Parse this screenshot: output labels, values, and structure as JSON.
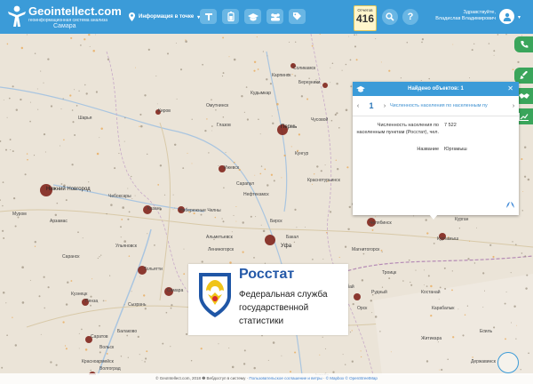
{
  "header": {
    "logo_title": "Geointellect",
    "logo_suffix": ".com",
    "logo_subtitle": "геоинформационная система анализа",
    "city": "Самара",
    "location_label": "Информация в точке",
    "counter_label": "Отчетов",
    "counter_value": "416",
    "greeting": "Здравствуйте,",
    "user_name": "Владислав Владимирович"
  },
  "panel": {
    "title": "Найдено объектов: 1",
    "page": "1",
    "tab_label": "Численность населения по населенным пу",
    "rows": [
      {
        "key": "Численность населения по населенным пунктам (Росстат), чел.",
        "value": "7 522"
      },
      {
        "key": "Название",
        "value": "Юргамыш"
      }
    ]
  },
  "rosstat": {
    "title": "Росстат",
    "subtitle_lines": [
      "Федеральная служба",
      "государственной",
      "статистики"
    ]
  },
  "map_labels": [
    {
      "text": "Соликамск",
      "big": false
    },
    {
      "text": "Березники",
      "big": false
    },
    {
      "text": "Кудымкар",
      "big": false
    },
    {
      "text": "Омутнинск",
      "big": false
    },
    {
      "text": "Киров",
      "big": false
    },
    {
      "text": "Глазов",
      "big": false
    },
    {
      "text": "Пермь",
      "big": true
    },
    {
      "text": "Чусовой",
      "big": false
    },
    {
      "text": "Шарья",
      "big": false
    },
    {
      "text": "Нижний Новгород",
      "big": true
    },
    {
      "text": "Чебоксары",
      "big": false
    },
    {
      "text": "Ижевск",
      "big": false
    },
    {
      "text": "Кунгур",
      "big": false
    },
    {
      "text": "Краснотурьинск",
      "big": false
    },
    {
      "text": "Казань",
      "big": false
    },
    {
      "text": "Сарапул",
      "big": false
    },
    {
      "text": "Нефтекамск",
      "big": false
    },
    {
      "text": "Набережные Челны",
      "big": false
    },
    {
      "text": "Альметьевск",
      "big": false
    },
    {
      "text": "Бирск",
      "big": false
    },
    {
      "text": "Уфа",
      "big": true
    },
    {
      "text": "Челябинск",
      "big": false
    },
    {
      "text": "Курган",
      "big": false
    },
    {
      "text": "Куртамыш",
      "big": false
    },
    {
      "text": "Тольятти",
      "big": false
    },
    {
      "text": "Самара",
      "big": false
    },
    {
      "text": "Ульяновск",
      "big": false
    },
    {
      "text": "Пенза",
      "big": false
    },
    {
      "text": "Саратов",
      "big": false
    },
    {
      "text": "Балаково",
      "big": false
    },
    {
      "text": "Вольск",
      "big": false
    },
    {
      "text": "Сызрань",
      "big": false
    },
    {
      "text": "Бузулук",
      "big": false
    },
    {
      "text": "Орск",
      "big": false
    },
    {
      "text": "Магнитогорск",
      "big": false
    },
    {
      "text": "Троицк",
      "big": false
    },
    {
      "text": "Костанай",
      "big": false
    },
    {
      "text": "Рудный",
      "big": false
    },
    {
      "text": "Волгоград",
      "big": false
    },
    {
      "text": "Красноармейск",
      "big": false
    },
    {
      "text": "Муром",
      "big": false
    },
    {
      "text": "Арзамас",
      "big": false
    },
    {
      "text": "Саранск",
      "big": false
    },
    {
      "text": "Кузнецк",
      "big": false
    },
    {
      "text": "Белорецк",
      "big": false
    },
    {
      "text": "Актобе",
      "big": false
    },
    {
      "text": "Державинск",
      "big": false
    },
    {
      "text": "Житикара",
      "big": false
    },
    {
      "text": "Есиль",
      "big": false
    },
    {
      "text": "Карабалык",
      "big": false
    },
    {
      "text": "Лениногорск",
      "big": false
    },
    {
      "text": "Сибай",
      "big": false
    },
    {
      "text": "Карпинск",
      "big": false
    },
    {
      "text": "Бакал",
      "big": false
    }
  ],
  "footer": {
    "left": "© GeoIntellect.com, 2018 ❷ Вебдоступ в систему ·",
    "link1": "Пользовательское соглашение и ветры",
    "mid": " · ",
    "link2": "© Mapbox © OpenStreetMap"
  },
  "colors": {
    "brand": "#3b9bd8",
    "side_green": "#3aa55b",
    "dot_dark": "#7a1a12",
    "dot_orange": "#e8a24a"
  }
}
